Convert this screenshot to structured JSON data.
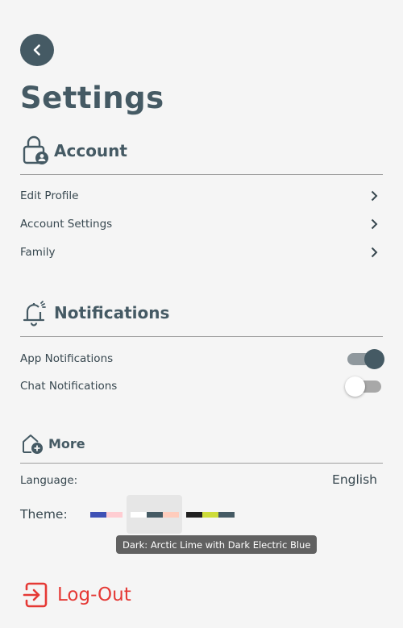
{
  "header": {
    "title": "Settings",
    "back_icon": "chevron-left-icon"
  },
  "account": {
    "heading": "Account",
    "icon": "lock-person-icon",
    "items": [
      {
        "label": "Edit Profile"
      },
      {
        "label": "Account Settings"
      },
      {
        "label": "Family"
      }
    ]
  },
  "notifications": {
    "heading": "Notifications",
    "icon": "bell-icon",
    "items": [
      {
        "label": "App Notifications",
        "enabled": true
      },
      {
        "label": "Chat Notifications",
        "enabled": false
      }
    ]
  },
  "more": {
    "heading": "More",
    "icon": "home-add-icon",
    "language_label": "Language:",
    "language_value": "English",
    "theme_label": "Theme:",
    "themes": [
      {
        "colors": [
          "#3f51b5",
          "#ffcdd2"
        ]
      },
      {
        "colors": [
          "#ffffff",
          "#455a64",
          "#ffccbc"
        ]
      },
      {
        "colors": [
          "#212121",
          "#cddc39",
          "#455a64"
        ]
      }
    ],
    "theme_tooltip": "Dark: Arctic Lime with Dark Electric Blue"
  },
  "logout": {
    "label": "Log-Out",
    "icon": "logout-icon"
  },
  "colors": {
    "primary": "#455a64",
    "background": "#f5f5f5",
    "danger": "#e53935"
  }
}
